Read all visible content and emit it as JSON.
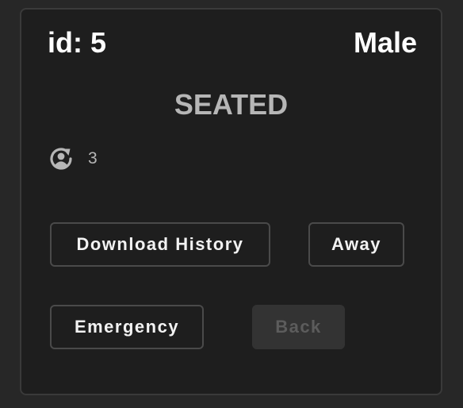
{
  "card": {
    "id_label": "id: 5",
    "gender": "Male",
    "status": "SEATED",
    "count_icon": "account-sync-icon",
    "count": "3"
  },
  "actions": {
    "download_history": "Download History",
    "away": "Away",
    "emergency": "Emergency",
    "back": "Back",
    "back_disabled": true
  },
  "colors": {
    "background": "#272727",
    "card": "#1e1e1e",
    "border": "#4a4a4a",
    "text": "#ffffff",
    "muted": "#b6b6b6",
    "disabled_bg": "#333333",
    "disabled_text": "#5c5c5c"
  }
}
